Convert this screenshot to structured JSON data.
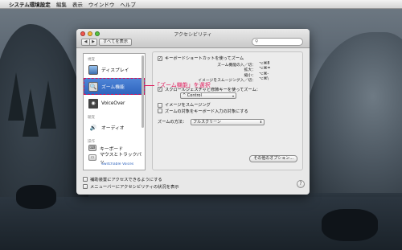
{
  "menubar": {
    "apple": "",
    "app_name": "システム環境設定",
    "items": [
      "編集",
      "表示",
      "ウインドウ",
      "ヘルプ"
    ]
  },
  "window": {
    "title": "アクセシビリティ",
    "show_all": "すべてを表示",
    "back": "◀",
    "forward": "▶",
    "search_placeholder": ""
  },
  "sidebar": {
    "category_vision": "視覚",
    "category_hearing": "聴覚",
    "category_interaction": "操作",
    "items": [
      {
        "label": "ディスプレイ",
        "icon": "display-icon"
      },
      {
        "label": "ズーム機能",
        "icon": "zoom-icon"
      },
      {
        "label": "VoiceOver",
        "icon": "voiceover-icon"
      },
      {
        "label": "オーディオ",
        "icon": "audio-icon"
      },
      {
        "label": "キーボード",
        "icon": "keyboard-icon"
      },
      {
        "label": "マウスとトラックパッ",
        "icon": "mouse-icon"
      }
    ],
    "cut_label": "Switchable Voices"
  },
  "zoom": {
    "keyboard_shortcut_label": "キーボードショートカットを使ってズーム",
    "shortcuts": [
      {
        "label": "ズーム機能の入／切：",
        "key": "⌥⌘8"
      },
      {
        "label": "拡大：",
        "key": "⌥⌘="
      },
      {
        "label": "縮小：",
        "key": "⌥⌘-"
      },
      {
        "label": "イメージをスムージング入／切：",
        "key": "⌥⌘\\"
      }
    ],
    "scroll_gesture_label": "スクロールジェスチャと修飾キーを使ってズーム：",
    "modifier_value": "^ Control",
    "smooth_images_label": "イメージをスムージング",
    "follow_focus_label": "ズームの対象をキーボード入力の対象にする",
    "zoom_style_label": "ズームの方法：",
    "zoom_style_value": "フルスクリーン",
    "more_options": "その他のオプション..."
  },
  "bottom": {
    "allow_label": "補助装置にアクセスできるようにする",
    "show_menu_label": "メニューバーにアクセシビリティの状況を表示",
    "help": "?"
  },
  "annotation": {
    "text": "「ズーム機能」を選択",
    "color": "#e0195a"
  }
}
